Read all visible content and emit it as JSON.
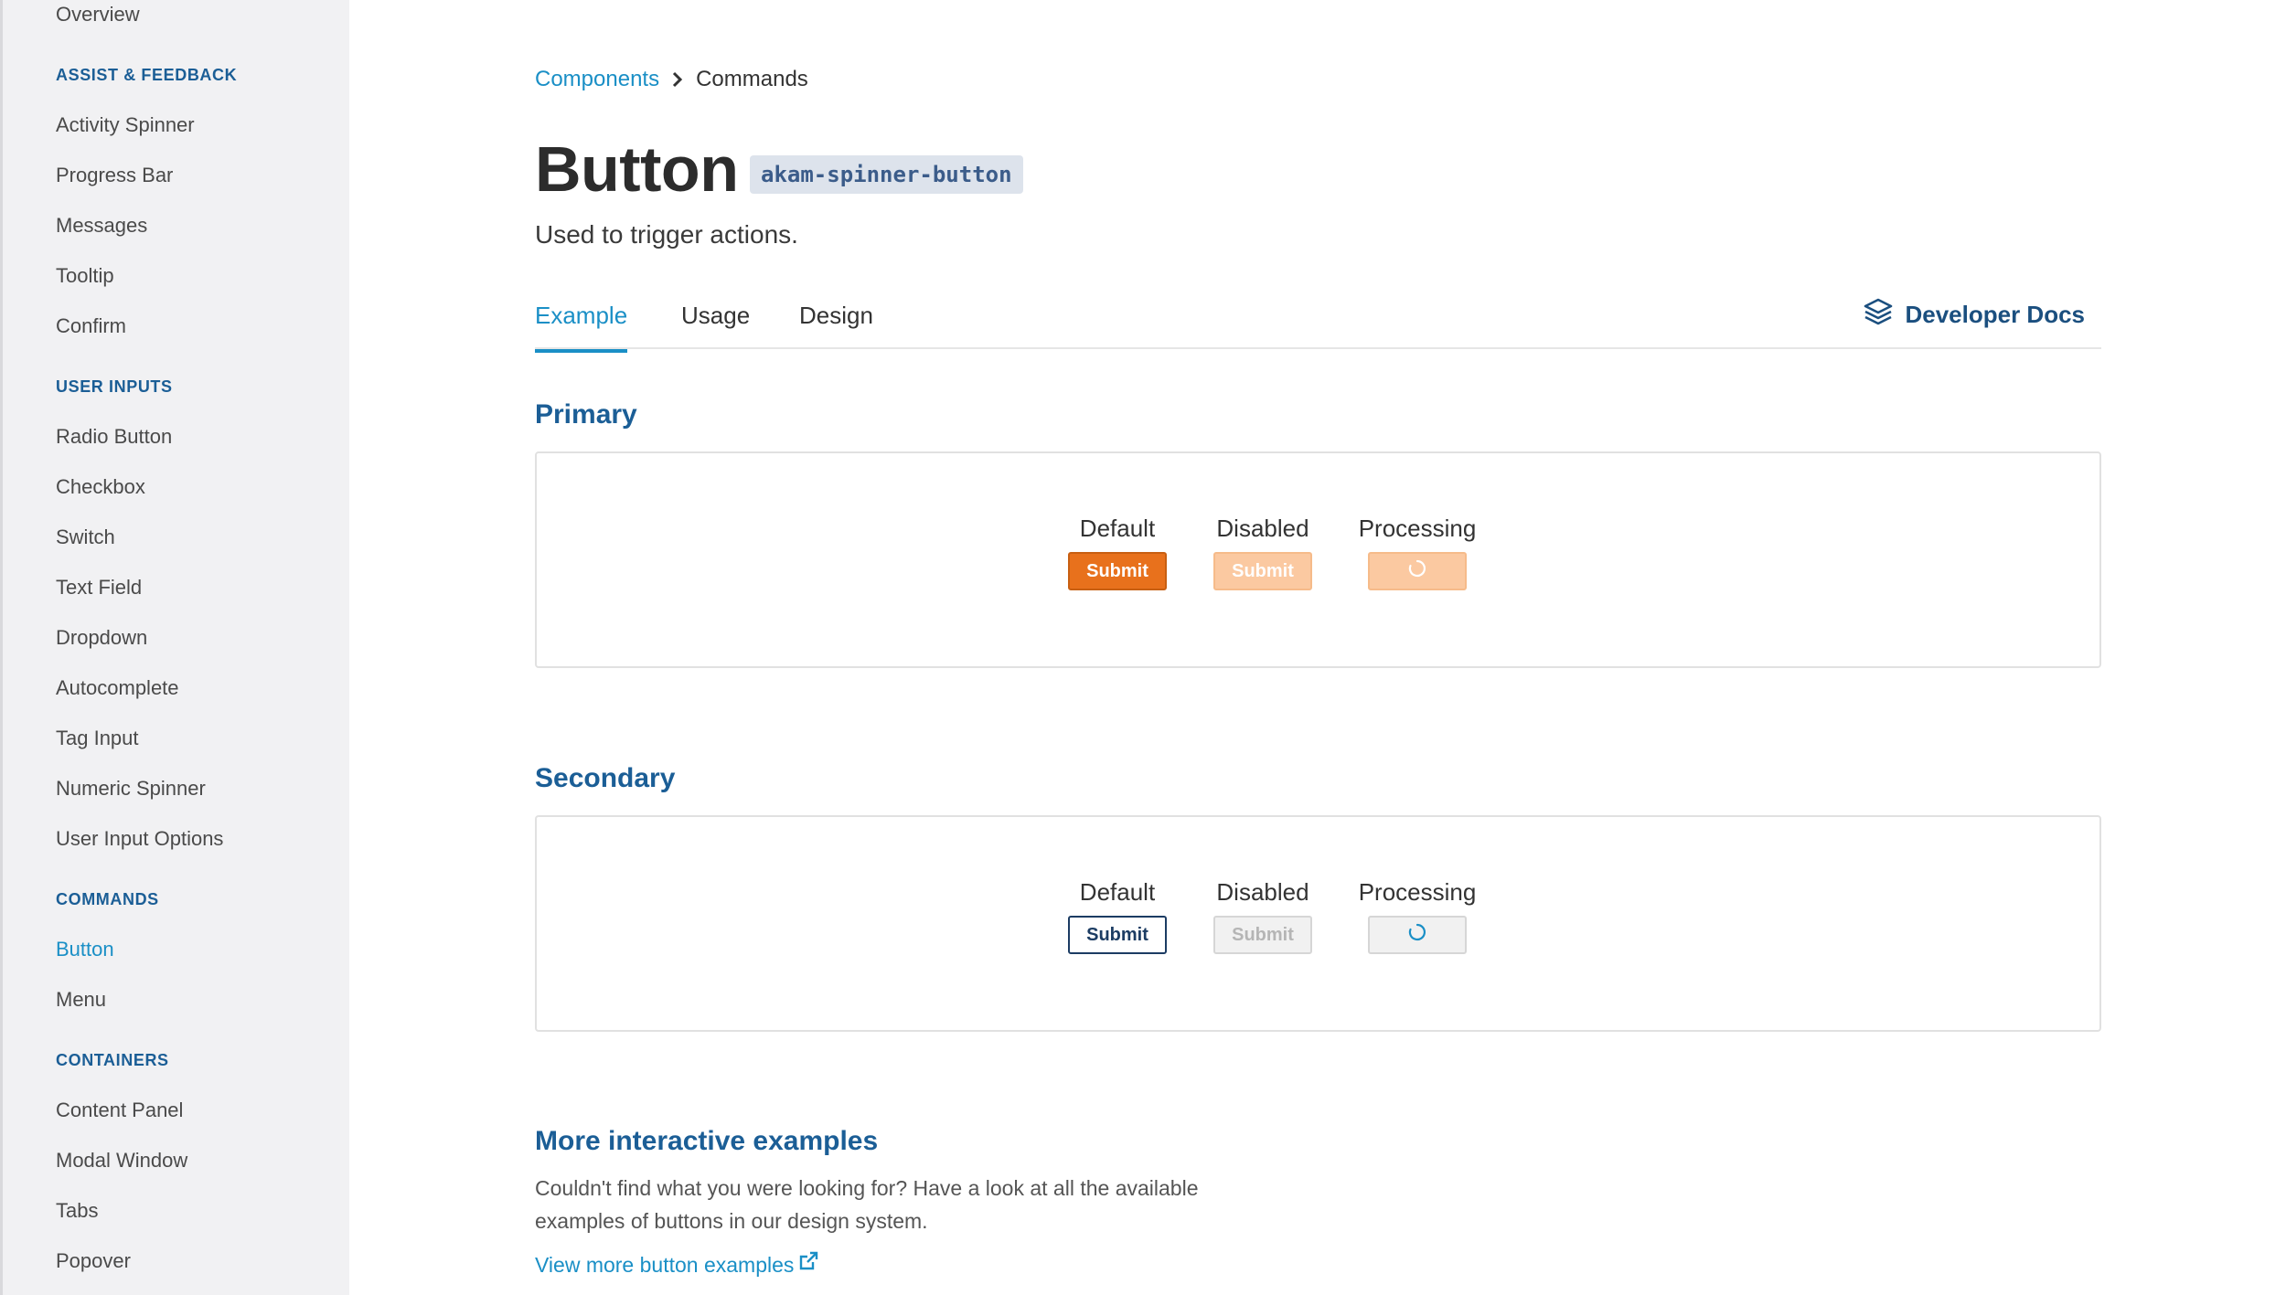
{
  "sidebar": {
    "overview": "Overview",
    "sections": [
      {
        "title": "ASSIST & FEEDBACK",
        "items": [
          "Activity Spinner",
          "Progress Bar",
          "Messages",
          "Tooltip",
          "Confirm"
        ]
      },
      {
        "title": "USER INPUTS",
        "items": [
          "Radio Button",
          "Checkbox",
          "Switch",
          "Text Field",
          "Dropdown",
          "Autocomplete",
          "Tag Input",
          "Numeric Spinner",
          "User Input Options"
        ]
      },
      {
        "title": "COMMANDS",
        "items": [
          "Button",
          "Menu"
        ]
      },
      {
        "title": "CONTAINERS",
        "items": [
          "Content Panel",
          "Modal Window",
          "Tabs",
          "Popover"
        ]
      }
    ],
    "active_item": "Button"
  },
  "breadcrumb": {
    "parent": "Components",
    "current": "Commands"
  },
  "page": {
    "title": "Button",
    "tag": "akam-spinner-button",
    "subtitle": "Used to trigger actions."
  },
  "tabs": [
    {
      "label": "Example",
      "active": true
    },
    {
      "label": "Usage",
      "active": false
    },
    {
      "label": "Design",
      "active": false
    }
  ],
  "developer_docs": {
    "label": "Developer Docs",
    "icon": "layers-icon"
  },
  "primary": {
    "title": "Primary",
    "states": {
      "default": "Default",
      "disabled": "Disabled",
      "processing": "Processing"
    },
    "button_label": "Submit"
  },
  "secondary": {
    "title": "Secondary",
    "states": {
      "default": "Default",
      "disabled": "Disabled",
      "processing": "Processing"
    },
    "button_label": "Submit"
  },
  "more": {
    "title": "More interactive examples",
    "text": "Couldn't find what you were looking for? Have a look at all the available examples of buttons in our design system.",
    "link": "View more button examples",
    "link_icon": "external-link-icon"
  },
  "colors": {
    "accent": "#1a8fc6",
    "heading": "#1b5e96",
    "primary_button": "#e8711c",
    "secondary_button_border": "#1c3c63"
  }
}
